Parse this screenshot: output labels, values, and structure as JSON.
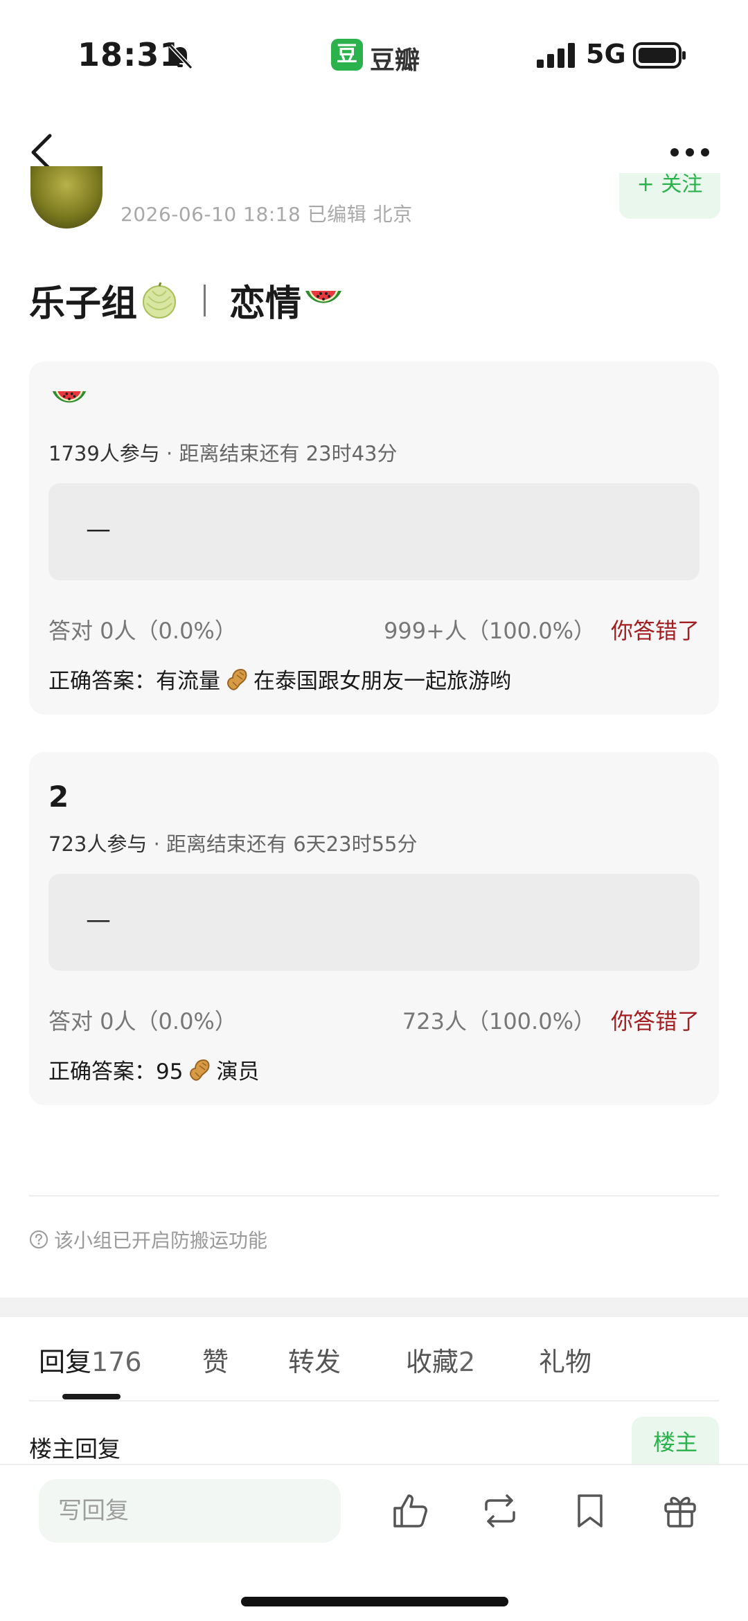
{
  "status_bar": {
    "time": "18:31",
    "app_badge": "豆",
    "app_name": "豆瓣",
    "network": "5G"
  },
  "post": {
    "meta": "2026-06-10 18:18  已编辑  北京",
    "follow_label": "+ 关注",
    "title_left": "乐子组",
    "title_right": "恋情"
  },
  "quizzes": [
    {
      "question": "",
      "participants": "1739人参与",
      "remaining": " · 距离结束还有 23时43分",
      "option": "—",
      "correct_stat": "答对  0人（0.0%）",
      "wrong_stat": "999+人（100.0%）",
      "result": "你答错了",
      "answer_prefix": "正确答案：有流量",
      "answer_suffix": "在泰国跟女朋友一起旅游哟"
    },
    {
      "question": "2",
      "participants": "723人参与",
      "remaining": " · 距离结束还有 6天23时55分",
      "option": "—",
      "correct_stat": "答对  0人（0.0%）",
      "wrong_stat": "723人（100.0%）",
      "result": "你答错了",
      "answer_prefix": "正确答案：95",
      "answer_suffix": "演员"
    }
  ],
  "notice": "该小组已开启防搬运功能",
  "tabs": [
    {
      "label": "回复",
      "count": "176"
    },
    {
      "label": "赞",
      "count": ""
    },
    {
      "label": "转发",
      "count": ""
    },
    {
      "label": "收藏",
      "count": "2"
    },
    {
      "label": "礼物",
      "count": ""
    }
  ],
  "op_reply_label": "楼主回复",
  "op_badge": "楼主",
  "bottom_bar": {
    "reply_placeholder": "写回复"
  },
  "colors": {
    "brand_green": "#2bb24c",
    "wrong_red": "#a31e22"
  },
  "icons": [
    "bell-off-icon",
    "signal-icon",
    "battery-icon",
    "back-icon",
    "more-icon",
    "melon-emoji-icon",
    "watermelon-emoji-icon",
    "peanut-emoji-icon",
    "question-circle-icon",
    "like-icon",
    "repost-icon",
    "bookmark-icon",
    "gift-icon"
  ]
}
